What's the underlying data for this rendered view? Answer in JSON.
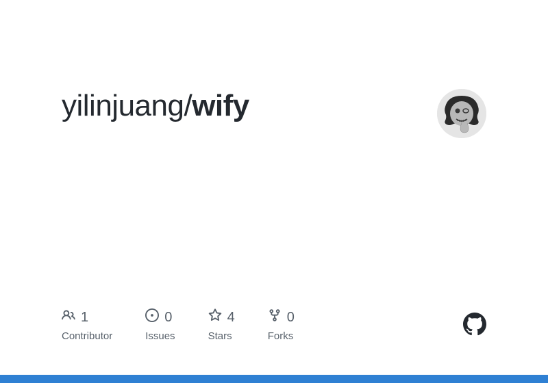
{
  "repo": {
    "owner": "yilinjuang",
    "name": "wify"
  },
  "stats": {
    "contributors": {
      "count": "1",
      "label": "Contributor"
    },
    "issues": {
      "count": "0",
      "label": "Issues"
    },
    "stars": {
      "count": "4",
      "label": "Stars"
    },
    "forks": {
      "count": "0",
      "label": "Forks"
    }
  },
  "colors": {
    "accent": "#2f80d3"
  }
}
